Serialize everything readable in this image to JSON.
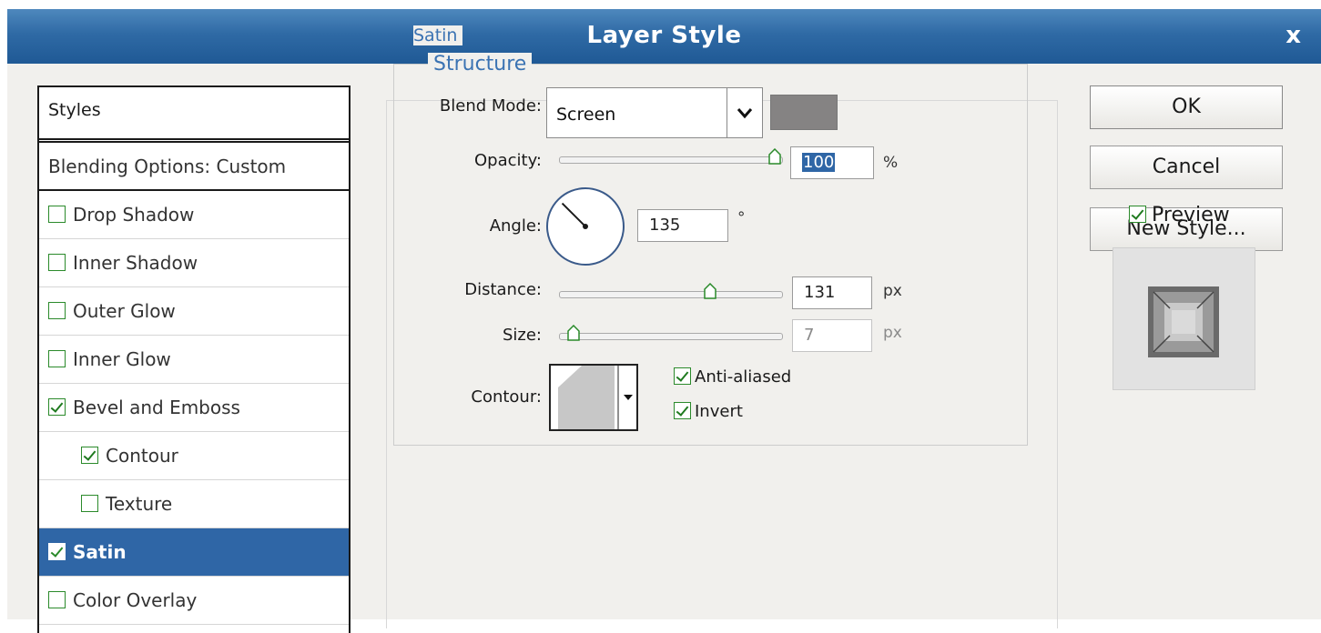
{
  "window": {
    "title": "Layer Style",
    "close_glyph": "x"
  },
  "styles_panel": {
    "header": "Styles",
    "blending_options": "Blending Options: Custom",
    "items": [
      {
        "label": "Drop Shadow",
        "checked": false,
        "indent": false,
        "selected": false
      },
      {
        "label": "Inner Shadow",
        "checked": false,
        "indent": false,
        "selected": false
      },
      {
        "label": "Outer Glow",
        "checked": false,
        "indent": false,
        "selected": false
      },
      {
        "label": "Inner Glow",
        "checked": false,
        "indent": false,
        "selected": false
      },
      {
        "label": "Bevel and Emboss",
        "checked": true,
        "indent": false,
        "selected": false
      },
      {
        "label": "Contour",
        "checked": true,
        "indent": true,
        "selected": false
      },
      {
        "label": "Texture",
        "checked": false,
        "indent": true,
        "selected": false
      },
      {
        "label": "Satin",
        "checked": true,
        "indent": false,
        "selected": true
      },
      {
        "label": "Color Overlay",
        "checked": false,
        "indent": false,
        "selected": false
      }
    ]
  },
  "satin": {
    "section_title": "Satin",
    "group_title": "Structure",
    "blend_mode": {
      "label": "Blend Mode:",
      "value": "Screen",
      "color": "#858383"
    },
    "opacity": {
      "label": "Opacity:",
      "value": "100",
      "unit": "%",
      "level": 1.0
    },
    "angle": {
      "label": "Angle:",
      "value": "135",
      "unit": "°"
    },
    "distance": {
      "label": "Distance:",
      "value": "131",
      "unit": "px",
      "level": 0.69
    },
    "size": {
      "label": "Size:",
      "value": "7",
      "unit": "px",
      "level": 0.04
    },
    "contour": {
      "label": "Contour:"
    },
    "anti_aliased": {
      "label": "Anti-aliased",
      "checked": true
    },
    "invert": {
      "label": "Invert",
      "checked": true
    }
  },
  "buttons": {
    "ok": "OK",
    "cancel": "Cancel",
    "new_style": "New Style..."
  },
  "preview": {
    "label": "Preview",
    "checked": true
  },
  "colors": {
    "title_bar": "#2f6aa5",
    "selection": "#2f66a6",
    "section_title": "#3b73b3",
    "check": "#2b8a2b"
  }
}
